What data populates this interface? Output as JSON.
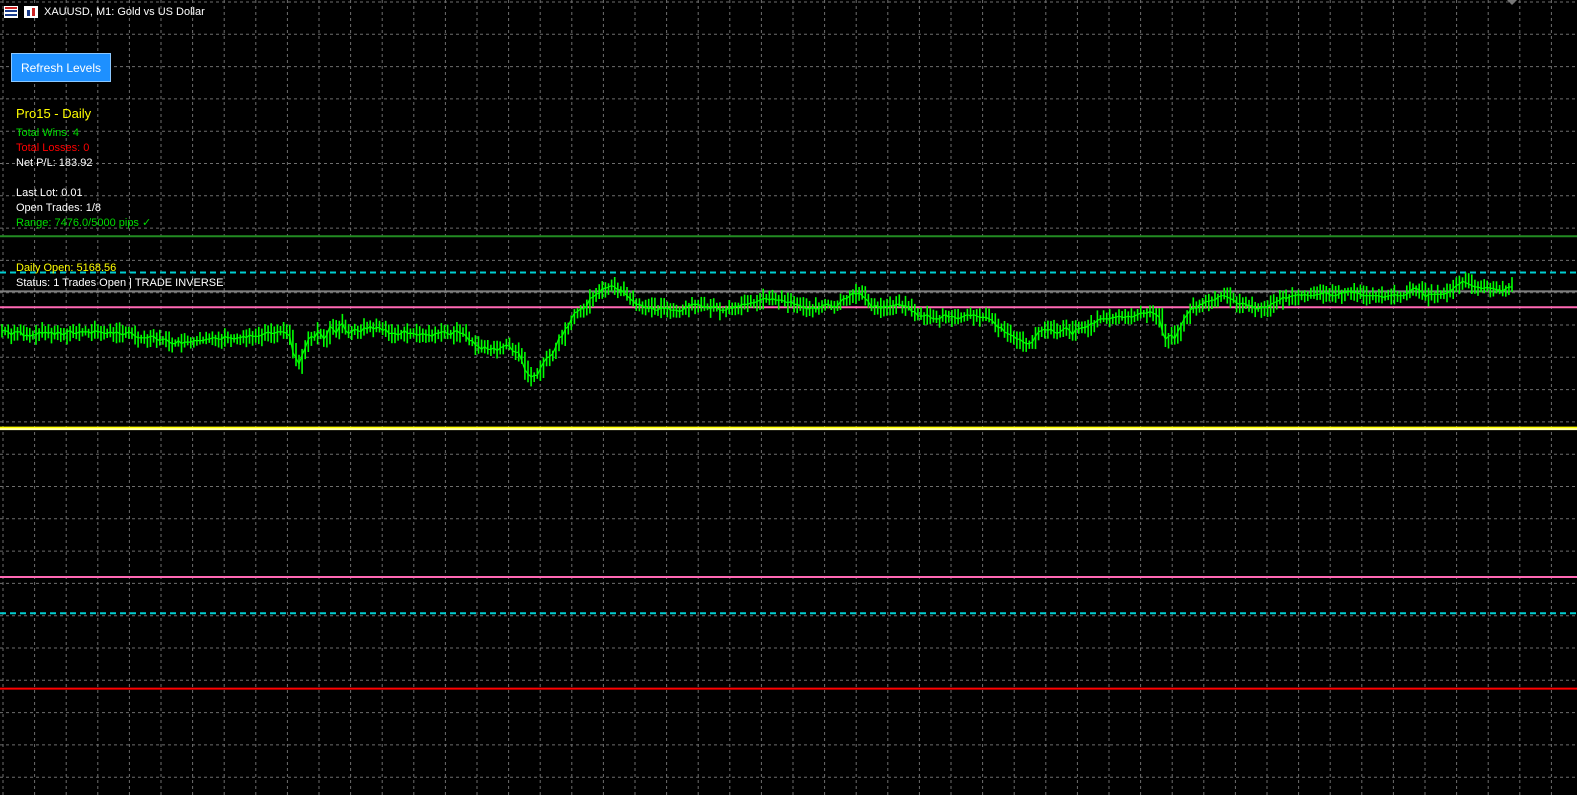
{
  "window": {
    "title": "XAUUSD, M1:  Gold vs US Dollar",
    "icons": [
      "grid-table-icon",
      "candlestick-chart-icon"
    ]
  },
  "toolbar": {
    "refresh_label": "Refresh Levels",
    "refresh_color": "#1e90ff"
  },
  "panel": {
    "title": "Pro15 - Daily",
    "total_wins": "Total Wins: 4",
    "total_losses": "Total Losses: 0",
    "net_pl": "Net P/L: 183.92",
    "last_lot": "Last Lot: 0.01",
    "open_trades": "Open Trades: 1/8",
    "range": "Range: 7476.0/5000 pips ✓",
    "daily_open": "Daily Open: 5168.56",
    "status": "Status: 1 Trades Open | TRADE INVERSE",
    "colors": {
      "title": "#ffff00",
      "wins": "#00dd00",
      "losses": "#ff0000",
      "neutral": "#ffffff",
      "range": "#00dd00",
      "daily_open": "#ffff00"
    }
  },
  "colors": {
    "background": "#000000",
    "grid": "#6e6e6e",
    "candles": "#00ff00"
  },
  "chart_data": {
    "type": "line",
    "symbol": "XAUUSD",
    "timeframe": "M1",
    "grid": true,
    "price_series": [
      0.5,
      0.5,
      0.49,
      0.47,
      0.49,
      0.49,
      0.49,
      0.46,
      0.47,
      0.46,
      0.47,
      0.47,
      0.49,
      0.48,
      0.49,
      0.48,
      0.49,
      0.47,
      0.49,
      0.48,
      0.47,
      0.49,
      0.5,
      0.48,
      0.48,
      0.49,
      0.49,
      0.49,
      0.49,
      0.48,
      0.5,
      0.49,
      0.49,
      0.48,
      0.48,
      0.49,
      0.48,
      0.49,
      0.48,
      0.47,
      0.48,
      0.49,
      0.48,
      0.46,
      0.45,
      0.45,
      0.45,
      0.45,
      0.46,
      0.46,
      0.44,
      0.43,
      0.44,
      0.44,
      0.42,
      0.41,
      0.41,
      0.43,
      0.41,
      0.42,
      0.42,
      0.42,
      0.43,
      0.43,
      0.43,
      0.43,
      0.44,
      0.44,
      0.45,
      0.45,
      0.44,
      0.44,
      0.46,
      0.45,
      0.45,
      0.44,
      0.45,
      0.45,
      0.46,
      0.45,
      0.47,
      0.46,
      0.46,
      0.46,
      0.47,
      0.48,
      0.49,
      0.48,
      0.48,
      0.49,
      0.49,
      0.49,
      0.48,
      0.46,
      0.35,
      0.31,
      0.27,
      0.33,
      0.38,
      0.44,
      0.46,
      0.45,
      0.49,
      0.48,
      0.44,
      0.47,
      0.53,
      0.51,
      0.48,
      0.53,
      0.55,
      0.5,
      0.48,
      0.49,
      0.51,
      0.5,
      0.49,
      0.52,
      0.51,
      0.53,
      0.51,
      0.52,
      0.52,
      0.5,
      0.51,
      0.48,
      0.48,
      0.48,
      0.47,
      0.48,
      0.5,
      0.48,
      0.48,
      0.48,
      0.47,
      0.47,
      0.48,
      0.47,
      0.47,
      0.46,
      0.48,
      0.48,
      0.49,
      0.49,
      0.48,
      0.47,
      0.49,
      0.5,
      0.48,
      0.48,
      0.46,
      0.43,
      0.43,
      0.4,
      0.39,
      0.37,
      0.39,
      0.37,
      0.37,
      0.38,
      0.36,
      0.38,
      0.39,
      0.4,
      0.39,
      0.36,
      0.35,
      0.35,
      0.29,
      0.23,
      0.2,
      0.18,
      0.19,
      0.19,
      0.24,
      0.28,
      0.31,
      0.32,
      0.34,
      0.39,
      0.45,
      0.46,
      0.51,
      0.53,
      0.58,
      0.62,
      0.63,
      0.65,
      0.65,
      0.67,
      0.72,
      0.73,
      0.75,
      0.76,
      0.79,
      0.79,
      0.8,
      0.81,
      0.8,
      0.78,
      0.78,
      0.76,
      0.74,
      0.72,
      0.7,
      0.68,
      0.68,
      0.67,
      0.66,
      0.65,
      0.66,
      0.64,
      0.64,
      0.66,
      0.65,
      0.66,
      0.64,
      0.64,
      0.64,
      0.63,
      0.64,
      0.66,
      0.67,
      0.68,
      0.68,
      0.68,
      0.67,
      0.66,
      0.66,
      0.65,
      0.67,
      0.66,
      0.64,
      0.64,
      0.64,
      0.66,
      0.65,
      0.67,
      0.66,
      0.68,
      0.68,
      0.68,
      0.69,
      0.69,
      0.7,
      0.71,
      0.72,
      0.72,
      0.71,
      0.72,
      0.71,
      0.71,
      0.71,
      0.7,
      0.69,
      0.7,
      0.68,
      0.68,
      0.67,
      0.66,
      0.65,
      0.65,
      0.66,
      0.65,
      0.65,
      0.67,
      0.68,
      0.68,
      0.67,
      0.66,
      0.67,
      0.7,
      0.72,
      0.72,
      0.74,
      0.76,
      0.75,
      0.76,
      0.74,
      0.72,
      0.7,
      0.66,
      0.67,
      0.67,
      0.65,
      0.67,
      0.66,
      0.67,
      0.67,
      0.68,
      0.68,
      0.67,
      0.67,
      0.66,
      0.63,
      0.63,
      0.6,
      0.6,
      0.6,
      0.61,
      0.59,
      0.58,
      0.58,
      0.58,
      0.6,
      0.61,
      0.59,
      0.6,
      0.59,
      0.58,
      0.59,
      0.6,
      0.61,
      0.6,
      0.61,
      0.6,
      0.59,
      0.59,
      0.59,
      0.58,
      0.57,
      0.54,
      0.52,
      0.52,
      0.49,
      0.48,
      0.47,
      0.46,
      0.44,
      0.44,
      0.42,
      0.41,
      0.41,
      0.42,
      0.46,
      0.49,
      0.5,
      0.51,
      0.5,
      0.51,
      0.49,
      0.48,
      0.49,
      0.51,
      0.52,
      0.5,
      0.47,
      0.51,
      0.51,
      0.52,
      0.52,
      0.53,
      0.55,
      0.55,
      0.57,
      0.58,
      0.58,
      0.58,
      0.58,
      0.59,
      0.59,
      0.6,
      0.59,
      0.59,
      0.6,
      0.59,
      0.6,
      0.61,
      0.62,
      0.62,
      0.62,
      0.63,
      0.62,
      0.61,
      0.59,
      0.49,
      0.44,
      0.46,
      0.47,
      0.44,
      0.49,
      0.53,
      0.58,
      0.61,
      0.64,
      0.66,
      0.65,
      0.68,
      0.68,
      0.7,
      0.7,
      0.71,
      0.71,
      0.73,
      0.74,
      0.74,
      0.73,
      0.72,
      0.71,
      0.69,
      0.68,
      0.69,
      0.68,
      0.67,
      0.67,
      0.65,
      0.65,
      0.66,
      0.66,
      0.66,
      0.68,
      0.69,
      0.7,
      0.71,
      0.73,
      0.72,
      0.73,
      0.74,
      0.74,
      0.75,
      0.74,
      0.75,
      0.74,
      0.74,
      0.74,
      0.75,
      0.75,
      0.76,
      0.76,
      0.75,
      0.74,
      0.74,
      0.75,
      0.76,
      0.76,
      0.77,
      0.77,
      0.76,
      0.76,
      0.75,
      0.74,
      0.74,
      0.74,
      0.74,
      0.74,
      0.74,
      0.73,
      0.73,
      0.74,
      0.74,
      0.75,
      0.74,
      0.74,
      0.74,
      0.75,
      0.77,
      0.79,
      0.79,
      0.78,
      0.76,
      0.73,
      0.75,
      0.75,
      0.75,
      0.75,
      0.75,
      0.75,
      0.76,
      0.77,
      0.79,
      0.81,
      0.82,
      0.84,
      0.83,
      0.82,
      0.81,
      0.8,
      0.8,
      0.79,
      0.79,
      0.8,
      0.79,
      0.79,
      0.78,
      0.78,
      0.77,
      0.79,
      0.8,
      0.8
    ],
    "levels": [
      {
        "color": "#228b22",
        "style": "solid",
        "price": 1.15
      },
      {
        "color": "#00ced1",
        "style": "dashed",
        "price": 0.9
      },
      {
        "color": "#808080",
        "style": "solid",
        "price": 0.77
      },
      {
        "color": "#ff69b4",
        "style": "solid",
        "price": 0.66
      },
      {
        "color": "#ffff00",
        "style": "solid",
        "price": -0.17
      },
      {
        "color": "#ffffaa",
        "style": "solid",
        "price": -0.18
      },
      {
        "color": "#ff69b4",
        "style": "solid",
        "price": -1.2
      },
      {
        "color": "#00ced1",
        "style": "dashed",
        "price": -1.45
      },
      {
        "color": "#ff0000",
        "style": "solid",
        "price": -1.97
      }
    ]
  }
}
